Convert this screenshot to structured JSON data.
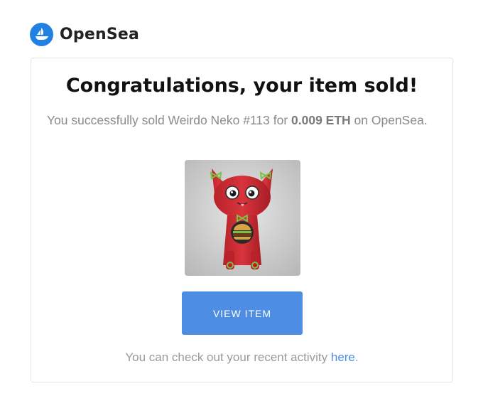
{
  "brand": {
    "name": "OpenSea",
    "color": "#2081E2",
    "icon": "opensea-sailboat-icon"
  },
  "email": {
    "title": "Congratulations, your item sold!",
    "message": {
      "prefix": "You successfully sold Weirdo Neko #113 for ",
      "price": "0.009 ETH",
      "suffix": " on OpenSea."
    },
    "item_image": "weirdo-neko-113-red-cat-figure",
    "button_label": "VIEW ITEM",
    "button_color": "#4E8DE4",
    "footer": {
      "prefix": "You can check out your recent activity ",
      "link_text": "here",
      "suffix": "."
    }
  }
}
